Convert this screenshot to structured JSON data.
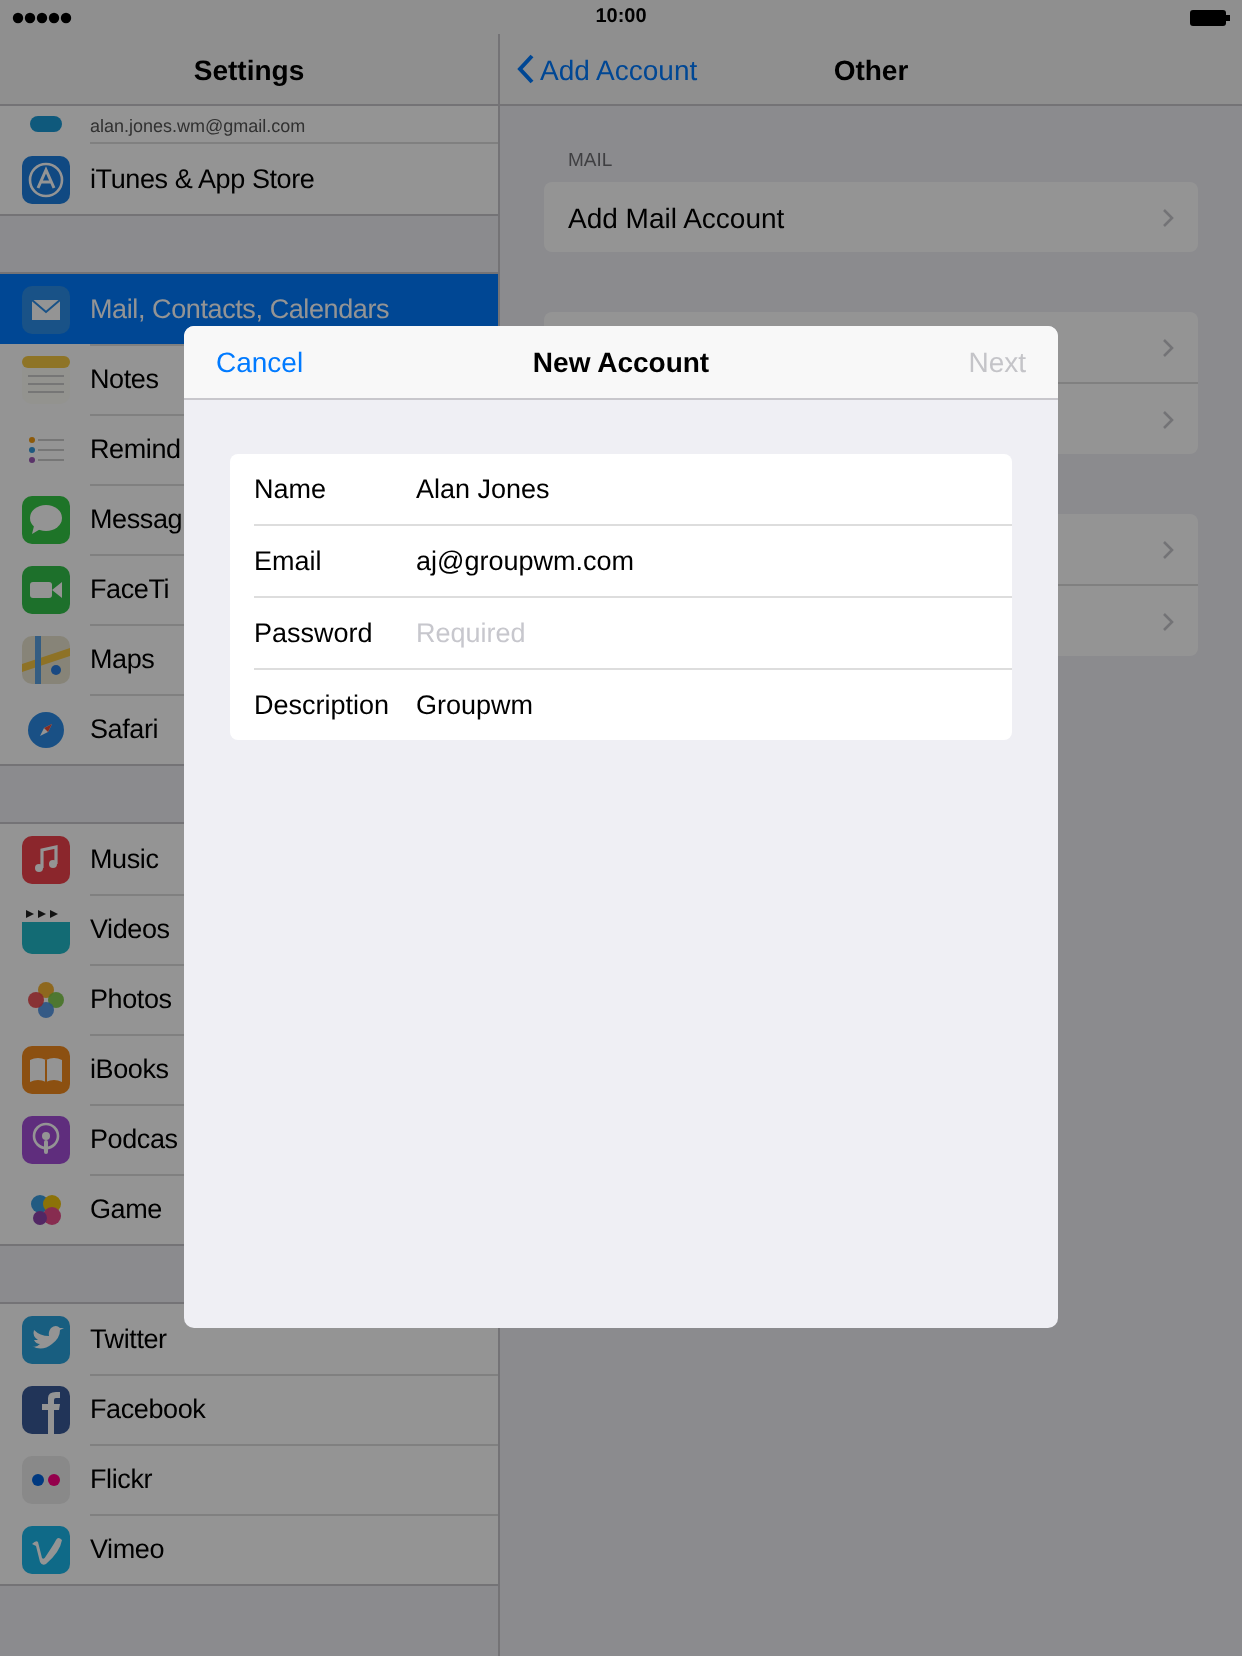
{
  "status_bar": {
    "time": "10:00"
  },
  "sidebar": {
    "title": "Settings",
    "groups": [
      {
        "items": [
          {
            "sublabel": "alan.jones.wm@gmail.com",
            "selected": false
          },
          {
            "label": "iTunes & App Store",
            "selected": false
          }
        ]
      },
      {
        "items": [
          {
            "label": "Mail, Contacts, Calendars",
            "selected": true
          },
          {
            "label": "Notes",
            "selected": false
          },
          {
            "label": "Remind",
            "selected": false
          },
          {
            "label": "Messag",
            "selected": false
          },
          {
            "label": "FaceTi",
            "selected": false
          },
          {
            "label": "Maps",
            "selected": false
          },
          {
            "label": "Safari",
            "selected": false
          }
        ]
      },
      {
        "items": [
          {
            "label": "Music",
            "selected": false
          },
          {
            "label": "Videos",
            "selected": false
          },
          {
            "label": "Photos",
            "selected": false
          },
          {
            "label": "iBooks",
            "selected": false
          },
          {
            "label": "Podcas",
            "selected": false
          },
          {
            "label": "Game",
            "selected": false
          }
        ]
      },
      {
        "items": [
          {
            "label": "Twitter",
            "selected": false
          },
          {
            "label": "Facebook",
            "selected": false
          },
          {
            "label": "Flickr",
            "selected": false
          },
          {
            "label": "Vimeo",
            "selected": false
          }
        ]
      }
    ]
  },
  "detail": {
    "back": "Add Account",
    "title": "Other",
    "sections": [
      {
        "header": "MAIL",
        "rows": [
          {
            "label": "Add Mail Account"
          }
        ]
      },
      {
        "rows": [
          {},
          {}
        ]
      },
      {
        "rows": [
          {},
          {}
        ]
      }
    ]
  },
  "modal": {
    "cancel": "Cancel",
    "title": "New Account",
    "next": {
      "label": "Next",
      "disabled": true
    },
    "fields": [
      {
        "label": "Name",
        "value": "Alan Jones"
      },
      {
        "label": "Email",
        "value": "aj@groupwm.com"
      },
      {
        "label": "Password",
        "placeholder": "Required"
      },
      {
        "label": "Description",
        "value": "Groupwm"
      }
    ]
  }
}
